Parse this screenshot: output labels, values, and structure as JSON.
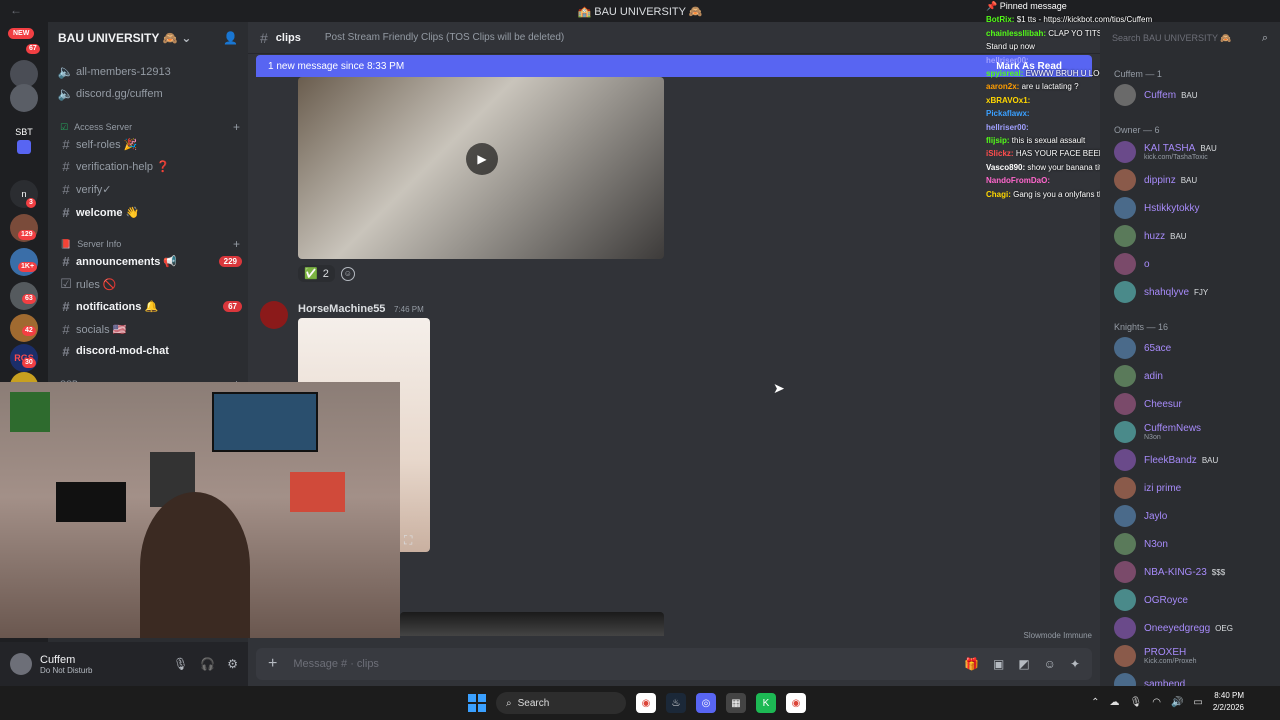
{
  "window": {
    "title": "🏫 BAU UNIVERSITY 🙈"
  },
  "servers": {
    "new_label": "NEW",
    "items": [
      {
        "label": "",
        "badge": "67"
      },
      {
        "label": "",
        "badge": ""
      },
      {
        "label": "SBT",
        "badge": ""
      },
      {
        "label": "",
        "badge": ""
      },
      {
        "label": "n",
        "badge": "3"
      },
      {
        "label": "",
        "badge": "129"
      },
      {
        "label": "",
        "badge": "1K+"
      },
      {
        "label": "",
        "badge": "63"
      },
      {
        "label": "",
        "badge": "42"
      },
      {
        "label": "RGS",
        "badge": "30"
      },
      {
        "label": "",
        "badge": "16"
      }
    ]
  },
  "guild": {
    "name": "BAU UNIVERSITY 🙈"
  },
  "channels": [
    {
      "name": "all-members-12913",
      "badge": ""
    },
    {
      "name": "discord.gg/cuffem",
      "badge": ""
    },
    {
      "name": "self-roles 🎉",
      "badge": ""
    },
    {
      "name": "verification-help ❓",
      "badge": ""
    },
    {
      "name": "verify✓",
      "badge": ""
    },
    {
      "name": "welcome 👋",
      "badge": ""
    },
    {
      "name": "announcements 📢",
      "badge": "229"
    },
    {
      "name": "rules 🚫",
      "badge": ""
    },
    {
      "name": "notifications 🔔",
      "badge": "67"
    },
    {
      "name": "socials 🇺🇸",
      "badge": ""
    },
    {
      "name": "discord-mod-chat",
      "badge": ""
    }
  ],
  "categories": {
    "access": "Access Server",
    "info": "Server Info",
    "ssb": "SSB"
  },
  "user": {
    "name": "Cuffem",
    "status": "Do Not Disturb"
  },
  "channel_header": {
    "name": "clips",
    "topic": "Post Stream Friendly Clips (TOS Clips will be deleted)"
  },
  "new_messages": {
    "text": "1 new message since 8:33 PM",
    "mark_read": "Mark As Read"
  },
  "reactions": {
    "count": "2"
  },
  "message2": {
    "author": "HorseMachine55",
    "time": "7:46 PM"
  },
  "slowmode": "Slowmode Immune",
  "composer": {
    "placeholder": "Message # · clips"
  },
  "chat": {
    "pinned": "Pinned message",
    "lines": [
      {
        "user": "BotRix:",
        "text": "$1 tts - https://kickbot.com/tips/Cuffem",
        "color": "#53fc18"
      },
      {
        "user": "chainlessllibah:",
        "text": "CLAP YO TITS LIKE ITS 4th of july @cuffem",
        "color": "#53fc18"
      },
      {
        "user": "",
        "text": "Stand up now",
        "color": "#ff4d4d"
      },
      {
        "user": "hellriser00:",
        "text": "",
        "color": "#a0a0ff"
      },
      {
        "user": "spyisreal:",
        "text": "EWWW BRUH U LOOK LIKE TABBATHA HUNT",
        "color": "#53fc18"
      },
      {
        "user": "aaron2x:",
        "text": "are u lactating ?",
        "color": "#ff9d00"
      },
      {
        "user": "xBRAVOx1:",
        "text": "",
        "color": "#ffd700"
      },
      {
        "user": "Pickaflawx:",
        "text": "",
        "color": "#3aa0ff"
      },
      {
        "user": "hellriser00:",
        "text": "",
        "color": "#a0a0ff"
      },
      {
        "user": "flijsip:",
        "text": "this is sexual assault",
        "color": "#53fc18"
      },
      {
        "user": "iSlickz:",
        "text": "HAS YOUR FACE BEEN STUNG BY A BEE TODAY??",
        "color": "#ff4d4d"
      },
      {
        "user": "Vasco890:",
        "text": "show your banana tits",
        "color": "#ffffff"
      },
      {
        "user": "NandoFromDaO:",
        "text": "",
        "color": "#ff66cc"
      },
      {
        "user": "Chagi:",
        "text": "Gang is you a onlyfans thot teasing tits?",
        "color": "#ffd700"
      }
    ]
  },
  "members": {
    "search_placeholder": "Search BAU UNIVERSITY 🙈",
    "groups": [
      {
        "title": "Cuffem — 1"
      },
      {
        "title": "Owner — 6"
      },
      {
        "title": "Knights — 16"
      }
    ],
    "owner_group": [
      {
        "name": "Cuffem",
        "tag": "BAU",
        "sub": ""
      }
    ],
    "owners": [
      {
        "name": "KAI TASHA",
        "tag": "BAU",
        "sub": "kick.com/TashaToxic"
      },
      {
        "name": "dippinz",
        "tag": "BAU",
        "sub": ""
      },
      {
        "name": "Hstikkytokky",
        "tag": "",
        "sub": ""
      },
      {
        "name": "huzz",
        "tag": "BAU",
        "sub": ""
      },
      {
        "name": "o",
        "tag": "",
        "sub": ""
      },
      {
        "name": "shahqlyve",
        "tag": "FJY",
        "sub": ""
      }
    ],
    "knights": [
      {
        "name": "65ace",
        "tag": "",
        "sub": ""
      },
      {
        "name": "adin",
        "tag": "",
        "sub": ""
      },
      {
        "name": "Cheesur",
        "tag": "",
        "sub": ""
      },
      {
        "name": "CuffemNews",
        "tag": "",
        "sub": "N3on"
      },
      {
        "name": "FleekBandz",
        "tag": "BAU",
        "sub": ""
      },
      {
        "name": "izi prime",
        "tag": "",
        "sub": ""
      },
      {
        "name": "Jaylo",
        "tag": "",
        "sub": ""
      },
      {
        "name": "N3on",
        "tag": "",
        "sub": ""
      },
      {
        "name": "NBA-KING-23",
        "tag": "$$$",
        "sub": ""
      },
      {
        "name": "OGRoyce",
        "tag": "",
        "sub": ""
      },
      {
        "name": "Oneeyedgregg",
        "tag": "OEG",
        "sub": ""
      },
      {
        "name": "PROXEH",
        "tag": "",
        "sub": "Kick.com/Proxeh"
      },
      {
        "name": "sambend",
        "tag": "",
        "sub": ""
      }
    ]
  },
  "taskbar": {
    "search": "Search",
    "time": "8:40 PM",
    "date": "2/2/2026"
  },
  "colors": {
    "accent": "#5865f2",
    "sidebar": "#2b2d31",
    "main": "#313338"
  }
}
